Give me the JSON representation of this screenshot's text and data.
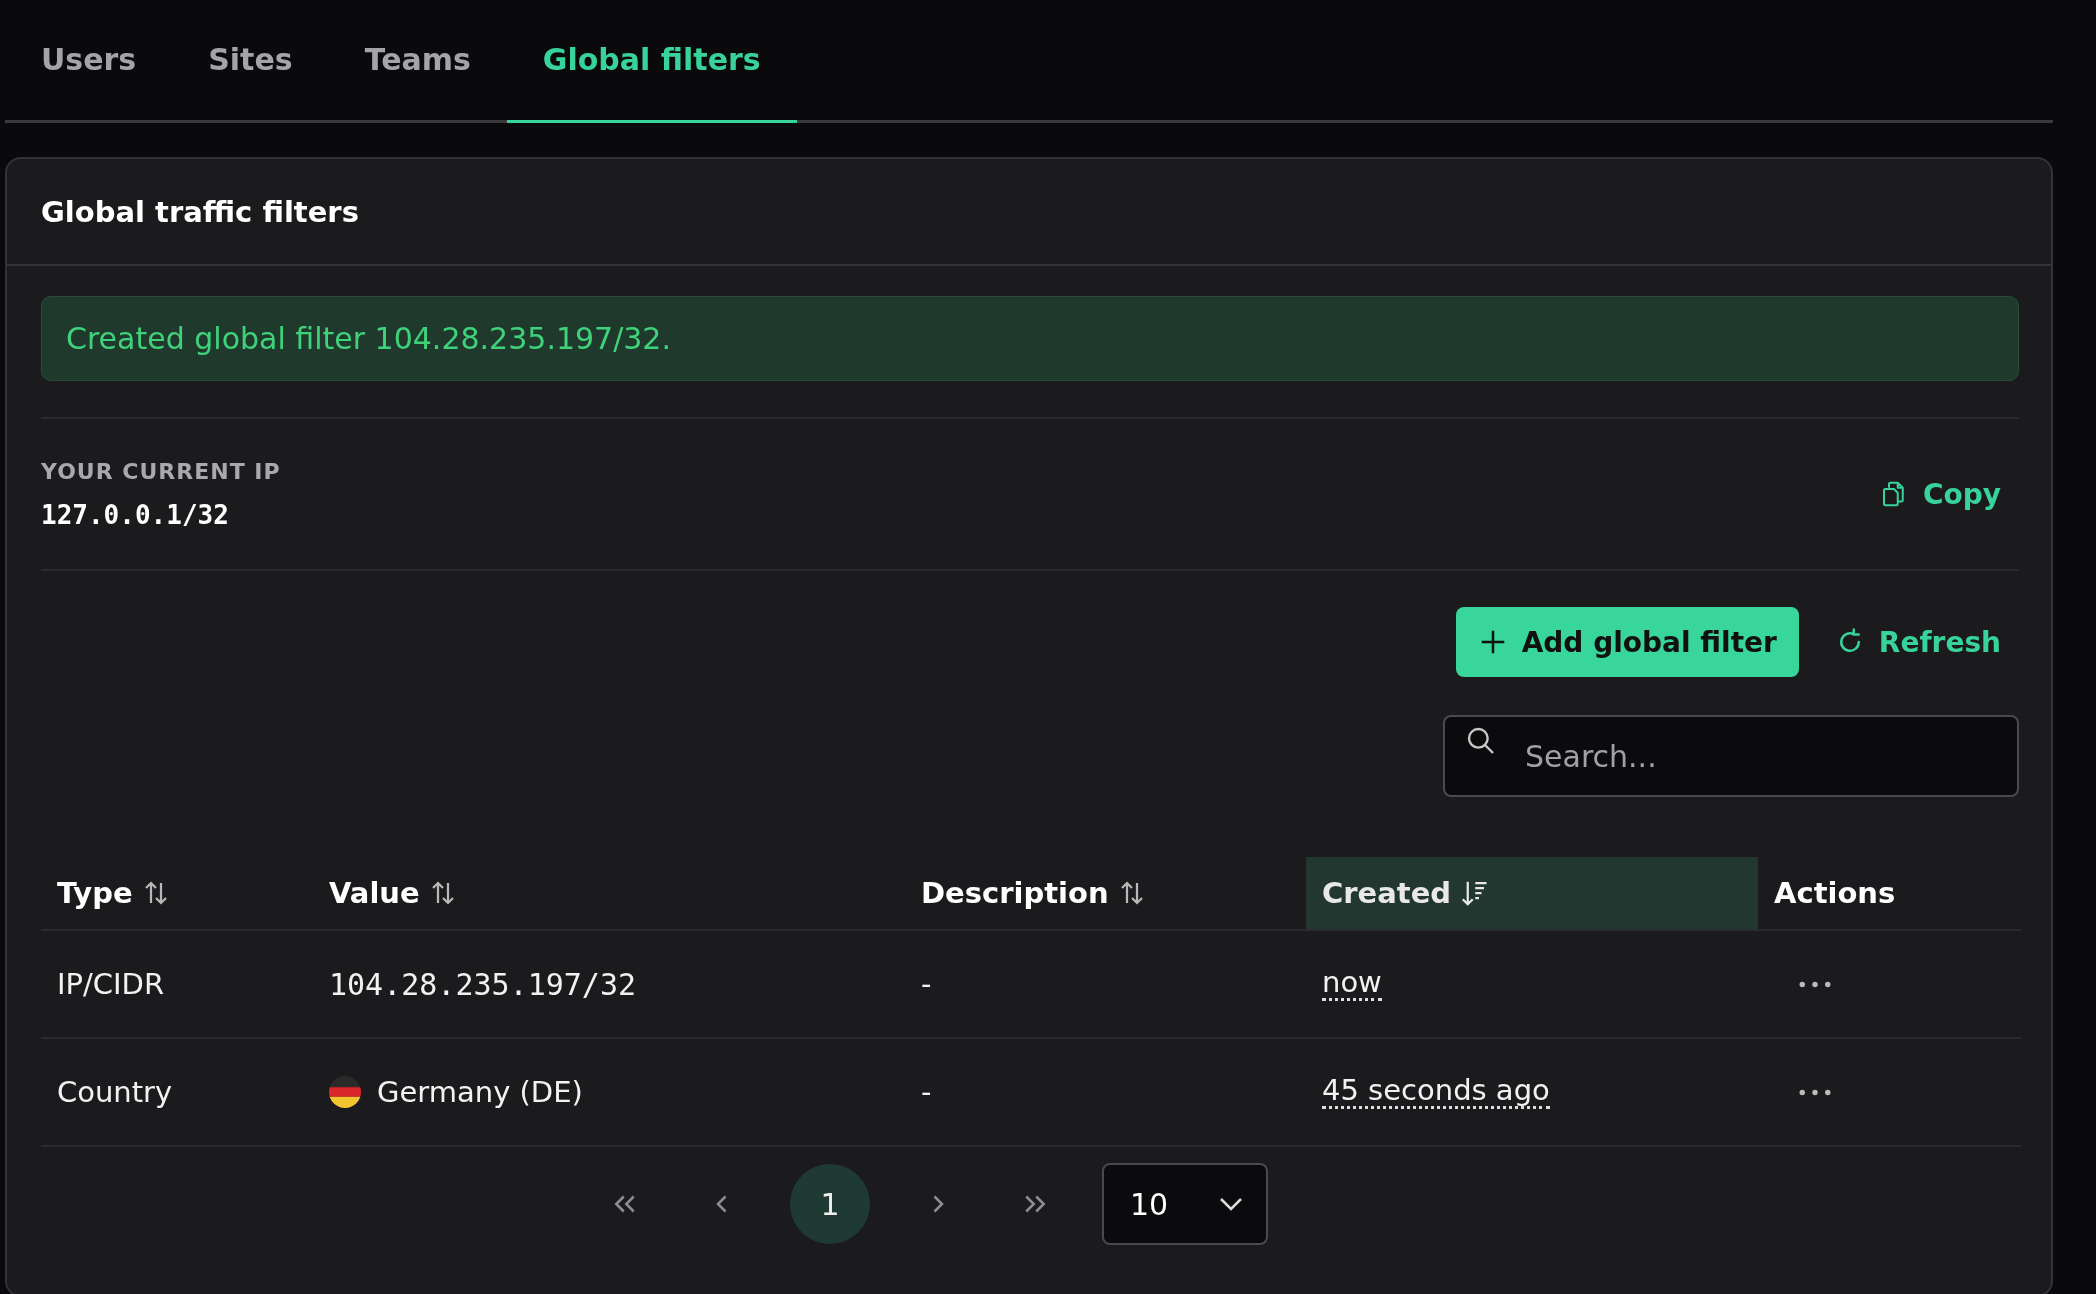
{
  "tabs": [
    {
      "label": "Users",
      "selected": false
    },
    {
      "label": "Sites",
      "selected": false
    },
    {
      "label": "Teams",
      "selected": false
    },
    {
      "label": "Global filters",
      "selected": true
    }
  ],
  "card": {
    "title": "Global traffic filters",
    "alert": "Created global filter 104.28.235.197/32.",
    "current_ip": {
      "label": "YOUR CURRENT IP",
      "value": "127.0.0.1/32",
      "copy_label": "Copy"
    },
    "add_button": "Add global filter",
    "refresh_button": "Refresh",
    "search": {
      "placeholder": "Search..."
    },
    "table": {
      "columns": [
        {
          "label": "Type",
          "sortable": true,
          "sorted": false
        },
        {
          "label": "Value",
          "sortable": true,
          "sorted": false
        },
        {
          "label": "Description",
          "sortable": true,
          "sorted": false
        },
        {
          "label": "Created",
          "sortable": true,
          "sorted": true
        },
        {
          "label": "Actions",
          "sortable": false,
          "sorted": false
        }
      ],
      "rows": [
        {
          "type": "IP/CIDR",
          "kind": "ip",
          "value": "104.28.235.197/32",
          "description": "-",
          "created": "now"
        },
        {
          "type": "Country",
          "kind": "country",
          "value": "Germany (DE)",
          "description": "-",
          "created": "45 seconds ago"
        }
      ]
    },
    "pagination": {
      "page": "1",
      "page_size": "10"
    }
  }
}
